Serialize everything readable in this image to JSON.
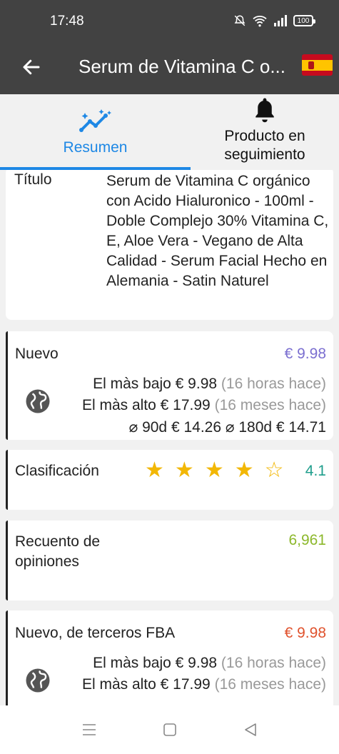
{
  "status_bar": {
    "time": "17:48",
    "battery": "100"
  },
  "app_bar": {
    "title": "Serum de Vitamina C o..."
  },
  "tabs": [
    {
      "label": "Resumen"
    },
    {
      "label": "Producto en seguimiento"
    }
  ],
  "product": {
    "title_label": "Título",
    "title_value": "Serum de Vitamina C orgánico con Acido Hialuronico - 100ml - Doble Complejo 30% Vitamina C, E, Aloe Vera - Vegano de Alta Calidad - Serum Facial Hecho en Alemania - Satin Naturel"
  },
  "new_price": {
    "label": "Nuevo",
    "current": "€ 9.98",
    "lowest_label": "El màs bajo",
    "lowest_value": "€ 9.98",
    "lowest_when": "(16 horas hace)",
    "highest_label": "El màs alto",
    "highest_value": "€ 17.99",
    "highest_when": "(16 meses hace)",
    "avg90_label": "⌀ 90d",
    "avg90_value": "€ 14.26",
    "avg180_label": "⌀ 180d",
    "avg180_value": "€ 14.71"
  },
  "rating": {
    "label": "Clasificación",
    "value": "4.1",
    "stars_filled": 4,
    "stars_total": 5
  },
  "reviews": {
    "label": "Recuento de opiniones",
    "value": "6,961"
  },
  "fba": {
    "label": "Nuevo, de terceros FBA",
    "current": "€ 9.98",
    "lowest_label": "El màs bajo",
    "lowest_value": "€ 9.98",
    "lowest_when": "(16 horas hace)",
    "highest_label": "El màs alto",
    "highest_value": "€ 17.99",
    "highest_when": "(16 meses hace)"
  },
  "colors": {
    "accent": "#1e88e5",
    "new_price": "#7b6fd0",
    "rating": "#1f9e8c",
    "reviews": "#8cb82b",
    "fba": "#e0522d",
    "star": "#f2b705"
  }
}
